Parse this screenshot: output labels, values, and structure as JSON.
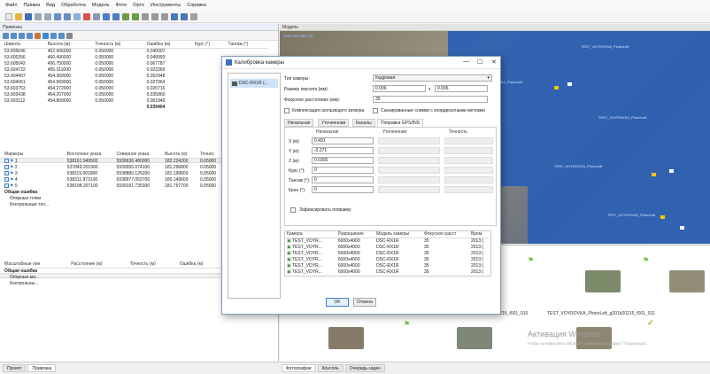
{
  "menu": [
    "Файл",
    "Правка",
    "Вид",
    "Обработка",
    "Модель",
    "Фото",
    "Орто",
    "Инструменты",
    "Справка"
  ],
  "left_panel": {
    "title": "Привязка",
    "cameras_table": {
      "headers": [
        "Широта",
        "Высота (м)",
        "Точность (м)",
        "Ошибка (м)",
        "Курс (°)",
        "Тангаж (°)"
      ],
      "rows": [
        [
          "53.605640",
          "462.666000",
          "0.050000",
          "0.040007"
        ],
        [
          "53.605356",
          "460.490000",
          "0.050000",
          "0.049993"
        ],
        [
          "53.605042",
          "456.750000",
          "0.050000",
          "0.067787"
        ],
        [
          "53.604722",
          "455.311000",
          "0.050000",
          "0.023369"
        ],
        [
          "53.604407",
          "454.369000",
          "0.050000",
          "0.052948"
        ],
        [
          "53.604061",
          "454.569000",
          "0.050000",
          "0.027964"
        ],
        [
          "53.603753",
          "454.272000",
          "0.050000",
          "0.020716"
        ],
        [
          "53.603438",
          "454.207000",
          "0.050000",
          "0.035860"
        ],
        [
          "53.603112",
          "454.809000",
          "0.050000",
          "0.061849"
        ]
      ],
      "total_error": "0.039404"
    },
    "markers_table": {
      "headers": [
        "Маркеры",
        "Восточное указа",
        "Северное указа",
        "Высота (м)",
        "Точнос"
      ],
      "rows": [
        [
          "1",
          "538161.949500",
          "5939636.480000",
          "182.224200",
          "0.05000"
        ],
        [
          "2",
          "537849.201900",
          "5939555.074100",
          "181.296800",
          "0.05000"
        ],
        [
          "3",
          "538115.001800",
          "5938880.125200",
          "181.199600",
          "0.05000"
        ],
        [
          "4",
          "538311.973100",
          "5938977.053700",
          "180.149600",
          "0.05000"
        ],
        [
          "5",
          "538198.207100",
          "5939191.735300",
          "181.757700",
          "0.05000"
        ]
      ],
      "total_error_label": "Общая ошибка",
      "control_label": "Опорные точки",
      "check_label": "Контрольные точ..."
    },
    "scale_table": {
      "headers": [
        "Масштабные лин",
        "Расстояние (м)",
        "Точность (м)",
        "Ошибка (м)"
      ],
      "total_error_label": "Общая ошибка",
      "control_label": "Опорные ма...",
      "check_label": "Контрольны..."
    },
    "bottom_tabs": [
      "Проект",
      "Привязка"
    ]
  },
  "model_view": {
    "title": "Модель",
    "perspective": "Перспектива 30°",
    "cam_label": "TEST_VOYROVKA_PhotoLeft"
  },
  "photos_pane": {
    "labels": [
      "b20215_f001_010",
      "TEST_VOYROVKA_PhotoLeft_g201b20215_f001_011"
    ],
    "activation_title": "Активация Windows",
    "activation_sub": "Чтобы активировать Windows, перейдите в раздел \"Параметры\"."
  },
  "bottom_tabs": [
    "Фотографии",
    "Консоль",
    "Очередь задач"
  ],
  "dialog": {
    "title": "Калибровка камеры",
    "camera_item": "DSC-RX1R (...",
    "camera_type_label": "Тип камеры:",
    "camera_type_value": "Кадровая",
    "pixel_size_label": "Размер пиксела (мм):",
    "pixel_size_x": "0.006",
    "pixel_size_y": "0.006",
    "focal_label": "Фокусное расстояние (мм):",
    "focal_value": "35",
    "rolling_shutter_label": "Компенсация скользящего затвора",
    "scanned_label": "Сканированные снимки с координатными метками",
    "tabs": [
      "Начальная",
      "Уточненная",
      "Каналы",
      "Поправка GPS/INS"
    ],
    "gps_columns": [
      "Начальная",
      "Уточненная",
      "Точность"
    ],
    "gps_rows": [
      {
        "label": "X (м):",
        "value": "0.491"
      },
      {
        "label": "Y (м):",
        "value": "-0.271"
      },
      {
        "label": "Z (м):",
        "value": "0.0305"
      },
      {
        "label": "Курс (°):",
        "value": "0"
      },
      {
        "label": "Тангаж (°):",
        "value": "0"
      },
      {
        "label": "Крен (°):",
        "value": "0"
      }
    ],
    "fix_label": "Зафиксировать поправку",
    "cam_table_headers": [
      "Камера",
      "Разрешение",
      "Модель камеры",
      "Фокусное расст",
      "Врем"
    ],
    "cam_table_rows": [
      [
        "TEST_VOYR...",
        "6000x4000",
        "DSC-RX1R",
        "35",
        "2013:("
      ],
      [
        "TEST_VOYR...",
        "6000x4000",
        "DSC-RX1R",
        "35",
        "2013:("
      ],
      [
        "TEST_VOYR...",
        "6000x4000",
        "DSC-RX1R",
        "35",
        "2013:("
      ],
      [
        "TEST_VOYR...",
        "6000x4000",
        "DSC-RX1R",
        "35",
        "2013:("
      ],
      [
        "TEST_VOYR...",
        "6000x4000",
        "DSC-RX1R",
        "35",
        "2013:("
      ],
      [
        "TEST_VOYR...",
        "6000x4000",
        "DSC-RX1R",
        "35",
        "2013:("
      ]
    ],
    "ok_label": "OK",
    "cancel_label": "Отмена"
  }
}
